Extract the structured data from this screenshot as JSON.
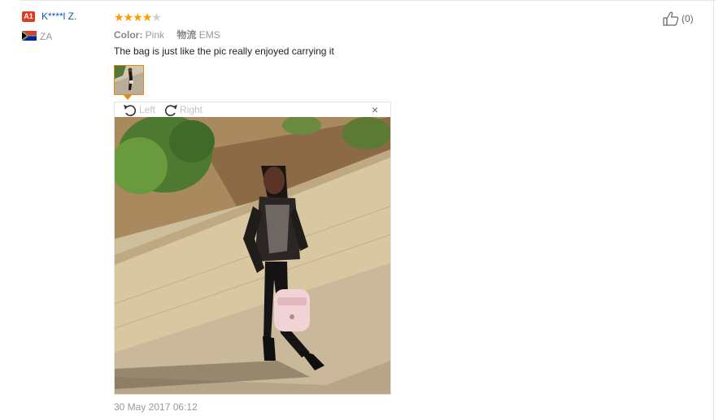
{
  "reviewer": {
    "badge": "A1",
    "name": "K****l Z.",
    "country": "ZA"
  },
  "rating": {
    "stars": 4,
    "max": 5
  },
  "attributes": {
    "color_label": "Color:",
    "color_value": "Pink",
    "shipping_label": "物流",
    "shipping_value": "EMS"
  },
  "review": {
    "text": "The bag is just like the pic really enjoyed carrying it",
    "date": "30 May 2017 06:12"
  },
  "viewer": {
    "rotate_left_label": "Left",
    "rotate_right_label": "Right",
    "close_symbol": "×"
  },
  "helpful": {
    "count_label": "(0)"
  },
  "colors": {
    "accent_star": "#ff9a00",
    "username": "#0e5cad",
    "badge": "#e03b21",
    "thumb_border": "#e08a1e"
  },
  "icons": [
    "rotate-left-icon",
    "rotate-right-icon",
    "close-icon",
    "thumbs-up-icon",
    "za-flag-icon"
  ]
}
